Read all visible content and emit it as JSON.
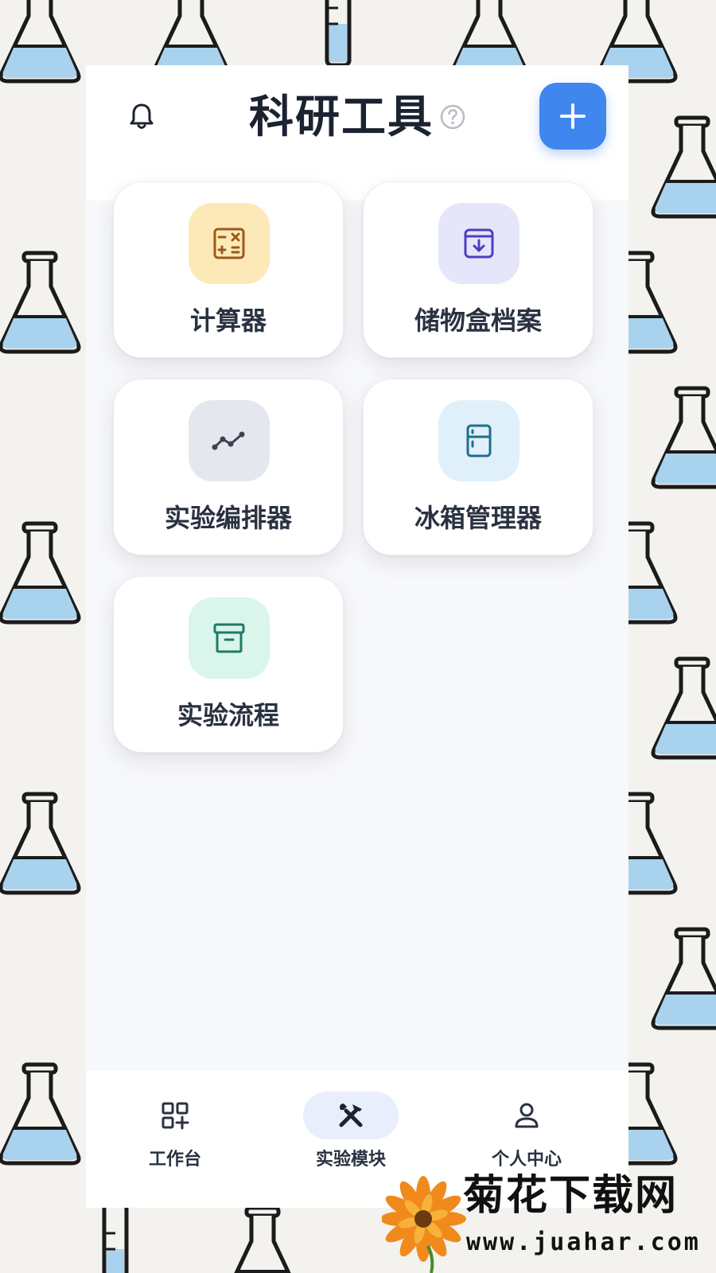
{
  "header": {
    "title": "科研工具",
    "left_icon": "bell-icon",
    "help_icon": "question-circle-icon",
    "add_icon": "plus-icon"
  },
  "tools": [
    {
      "label": "计算器",
      "icon": "calculator-icon",
      "tint": "#fde9b8",
      "accent": "#9b5a1a"
    },
    {
      "label": "储物盒档案",
      "icon": "archive-download-icon",
      "tint": "#e6e6fb",
      "accent": "#4b3ec4"
    },
    {
      "label": "实验编排器",
      "icon": "trend-line-icon",
      "tint": "#e4e7ee",
      "accent": "#3b4252"
    },
    {
      "label": "冰箱管理器",
      "icon": "fridge-icon",
      "tint": "#dff0fb",
      "accent": "#1f6e8c"
    },
    {
      "label": "实验流程",
      "icon": "box-icon",
      "tint": "#d9f5ec",
      "accent": "#1f7a64"
    }
  ],
  "tabbar": {
    "items": [
      {
        "label": "工作台",
        "icon": "grid-plus-icon",
        "active": false
      },
      {
        "label": "实验模块",
        "icon": "tools-icon",
        "active": true
      },
      {
        "label": "个人中心",
        "icon": "person-icon",
        "active": false
      }
    ]
  },
  "colors": {
    "primary": "#3f86ef",
    "active_tab_bg": "#e8eefc",
    "flask_liquid": "#a9d2ee"
  },
  "watermark": {
    "text": "菊花下载网",
    "url": "www.juahar.com"
  }
}
